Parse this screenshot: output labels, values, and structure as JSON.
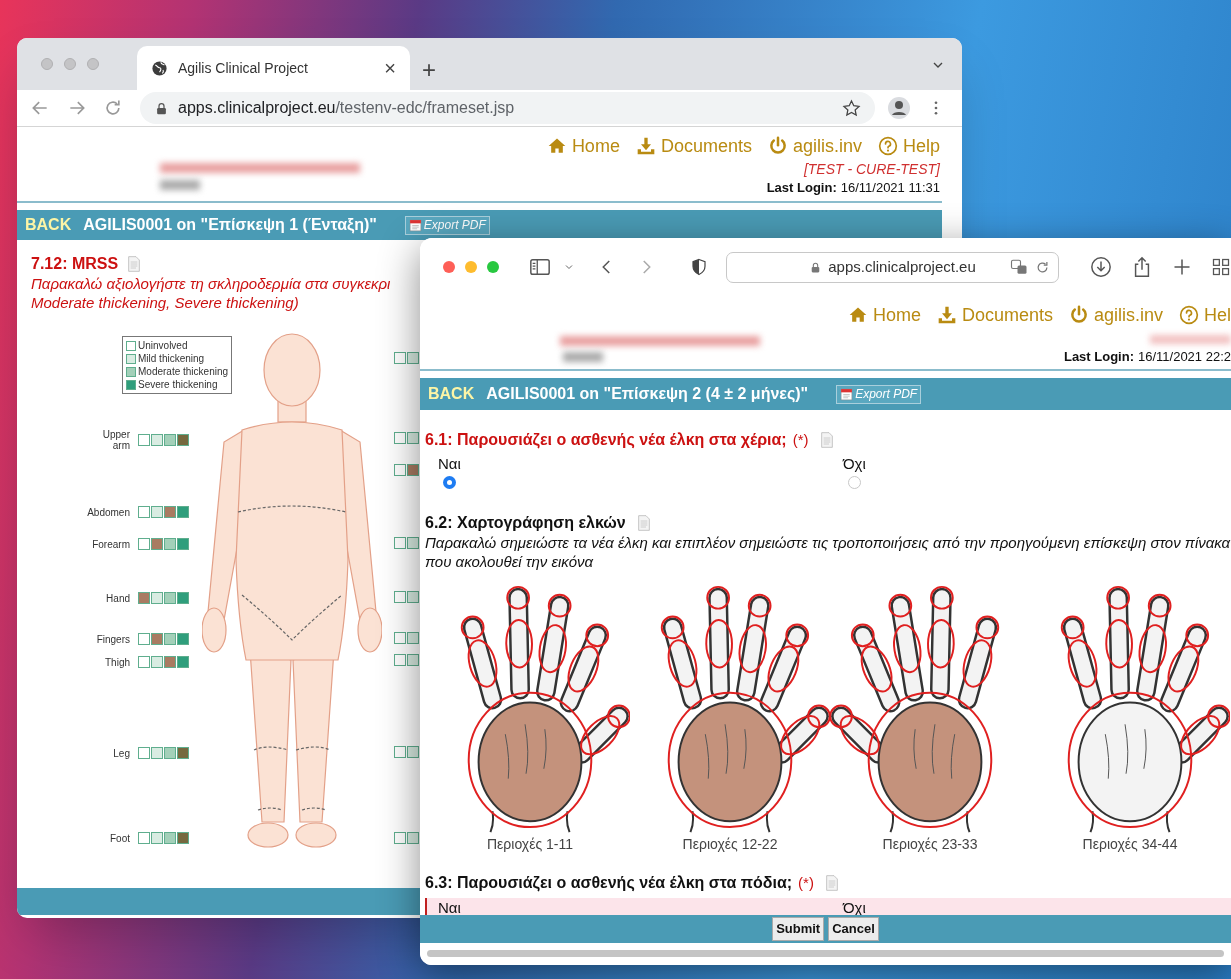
{
  "back_window": {
    "tab": {
      "title": "Agilis Clinical Project",
      "close": "×"
    },
    "new_tab": "+",
    "url": {
      "host": "apps.clinicalproject.eu",
      "path": "/testenv-edc/frameset.jsp"
    },
    "nav": [
      {
        "kind": "home",
        "label": "Home"
      },
      {
        "kind": "documents",
        "label": "Documents"
      },
      {
        "kind": "user",
        "label": "agilis.inv"
      },
      {
        "kind": "help",
        "label": "Help"
      }
    ],
    "environment": "[TEST - CURE-TEST]",
    "last_login": {
      "label": "Last Login:",
      "value": "16/11/2021 11:31"
    },
    "form_bar": {
      "back": "BACK",
      "title": "AGILIS0001 on \"Επίσκεψη 1 (Ένταξη)\"",
      "export": "Export PDF"
    },
    "question": {
      "title": "7.12: MRSS",
      "flagged": true,
      "instruction_lines": [
        "Παρακαλώ αξιολογήστε τη σκληροδερμία στα συγκεκρι",
        "Moderate thickening, Severe thickening)"
      ]
    },
    "figure": {
      "legend": [
        {
          "label": "Uninvolved",
          "color": "#ffffff"
        },
        {
          "label": "Mild thickening",
          "color": "#d9ece2"
        },
        {
          "label": "Moderate thickening",
          "color": "#a3d0b9"
        },
        {
          "label": "Severe thickening",
          "color": "#2f9e7c"
        }
      ],
      "left_regions": [
        {
          "label": "Upper arm",
          "boxes": [
            {
              "selected": false
            },
            {
              "selected": false
            },
            {
              "selected": false
            },
            {
              "selected": true
            }
          ]
        },
        {
          "label": "Abdomen",
          "boxes": [
            {
              "selected": false
            },
            {
              "selected": false
            },
            {
              "selected": true
            },
            {
              "selected": false
            }
          ]
        },
        {
          "label": "Forearm",
          "boxes": [
            {
              "selected": false
            },
            {
              "selected": true
            },
            {
              "selected": false
            },
            {
              "selected": false
            }
          ]
        },
        {
          "label": "Hand",
          "boxes": [
            {
              "selected": true
            },
            {
              "selected": false
            },
            {
              "selected": false
            },
            {
              "selected": false
            }
          ]
        },
        {
          "label": "Fingers",
          "boxes": [
            {
              "selected": false
            },
            {
              "selected": true
            },
            {
              "selected": false
            },
            {
              "selected": false
            }
          ]
        },
        {
          "label": "Thigh",
          "boxes": [
            {
              "selected": false
            },
            {
              "selected": false
            },
            {
              "selected": true
            },
            {
              "selected": false
            }
          ]
        },
        {
          "label": "Leg",
          "boxes": [
            {
              "selected": false
            },
            {
              "selected": false
            },
            {
              "selected": false
            },
            {
              "selected": true
            }
          ]
        },
        {
          "label": "Foot",
          "boxes": [
            {
              "selected": false
            },
            {
              "selected": false
            },
            {
              "selected": false
            },
            {
              "selected": true
            }
          ]
        }
      ],
      "right_regions": [
        {
          "boxes": [
            {
              "selected": false
            },
            {
              "selected": false
            }
          ]
        },
        {
          "boxes": [
            {
              "selected": false
            },
            {
              "selected": false
            }
          ]
        },
        {
          "boxes": [
            {
              "selected": false
            },
            {
              "selected": true
            }
          ]
        },
        {
          "boxes": [
            {
              "selected": false
            },
            {
              "selected": false
            }
          ]
        },
        {
          "boxes": [
            {
              "selected": false
            },
            {
              "selected": false
            }
          ]
        },
        {
          "boxes": [
            {
              "selected": false
            },
            {
              "selected": false
            }
          ]
        },
        {
          "boxes": [
            {
              "selected": false
            },
            {
              "selected": false
            }
          ]
        },
        {
          "boxes": [
            {
              "selected": false
            },
            {
              "selected": false
            }
          ]
        },
        {
          "boxes": [
            {
              "selected": false
            },
            {
              "selected": false
            }
          ]
        }
      ]
    }
  },
  "front_window": {
    "url": {
      "host": "apps.clinicalproject.eu"
    },
    "nav": [
      {
        "kind": "home",
        "label": "Home"
      },
      {
        "kind": "documents",
        "label": "Documents"
      },
      {
        "kind": "user",
        "label": "agilis.inv"
      },
      {
        "kind": "help",
        "label": "Hel"
      }
    ],
    "last_login": {
      "label": "Last Login:",
      "value": "16/11/2021 22:2"
    },
    "form_bar": {
      "back": "BACK",
      "title": "AGILIS0001 on \"Επίσκεψη 2 (4 ± 2 μήνες)\"",
      "export": "Export PDF"
    },
    "questions": [
      {
        "kind": "radio",
        "title": "6.1: Παρουσιάζει ο ασθενής νέα έλκη στα χέρια;",
        "required": "(*)",
        "flagged": true,
        "options": [
          {
            "label": "Ναι",
            "selected": true
          },
          {
            "label": "Όχι",
            "selected": false
          }
        ]
      },
      {
        "kind": "figure",
        "title": "6.2: Χαρτογράφηση ελκών",
        "flagged": false,
        "instruction": "Παρακαλώ σημειώστε τα νέα έλκη και επιπλέον σημειώστε τις τροποποιήσεις από την προηγούμενη επίσκεψη στον πίνακα που ακολουθεί την εικόνα",
        "hands": [
          {
            "label": "Περιοχές 1-11",
            "filled": true
          },
          {
            "label": "Περιοχές 12-22",
            "filled": true
          },
          {
            "label": "Περιοχές 23-33",
            "filled": true
          },
          {
            "label": "Περιοχές 34-44",
            "filled": false
          }
        ]
      },
      {
        "kind": "radio",
        "title": "6.3: Παρουσιάζει ο ασθενής νέα έλκη στα πόδια;",
        "required": "(*)",
        "flagged": false,
        "highlighted": true,
        "options": [
          {
            "label": "Ναι"
          },
          {
            "label": "Όχι"
          }
        ]
      }
    ],
    "buttons": [
      {
        "label": "Submit"
      },
      {
        "label": "Cancel"
      }
    ]
  }
}
